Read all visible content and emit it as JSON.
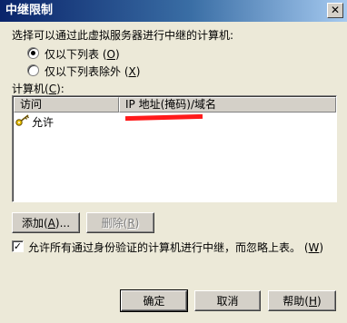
{
  "window": {
    "title": "中继限制",
    "close_glyph": "✕"
  },
  "prompt": "选择可以通过此虚拟服务器进行中继的计算机:",
  "radios": [
    {
      "label": "仅以下列表",
      "accel": "O",
      "checked": true
    },
    {
      "label": "仅以下列表除外",
      "accel": "X",
      "checked": false
    }
  ],
  "list": {
    "label": "计算机",
    "accel": "C",
    "columns": [
      "访问",
      "IP 地址(掩码)/域名"
    ],
    "rows": [
      {
        "access": "允许",
        "address_redacted": true
      }
    ]
  },
  "buttons": {
    "add": {
      "label": "添加",
      "accel": "A",
      "suffix": "..."
    },
    "remove": {
      "label": "删除",
      "accel": "R"
    },
    "ok": "确定",
    "cancel": "取消",
    "help": {
      "label": "帮助",
      "accel": "H"
    }
  },
  "checkbox": {
    "label": "允许所有通过身份验证的计算机进行中继，而忽略上表。",
    "accel": "W",
    "checked": true
  },
  "colors": {
    "dialog_bg": "#ece9d8",
    "title_start": "#0a246a",
    "title_end": "#a6caf0",
    "redaction": "#ff1a1a"
  },
  "icons": {
    "row_icon": "key-icon"
  }
}
